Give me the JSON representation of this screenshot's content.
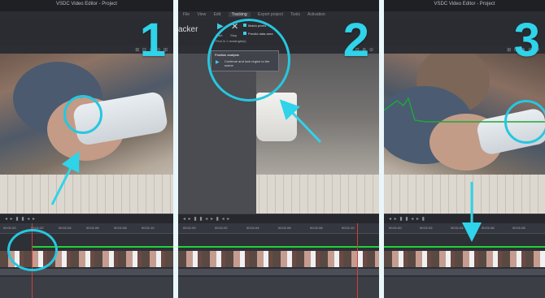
{
  "window": {
    "title": "VSDC Video Editor - Project"
  },
  "tabs": [
    "File",
    "View",
    "Edit",
    "Tracking",
    "Export project",
    "Tools",
    "Activation"
  ],
  "tracker_label": "acker",
  "ribbon": {
    "status": "Find in 1 rectangle(s)",
    "start_label": "Start",
    "stop_label": "Stop",
    "option_a": "Match pixels",
    "option_b": "Predict data area"
  },
  "popup": {
    "title": "Position analysis",
    "text": "Continue and lock region to the scene"
  },
  "numbers": [
    "1",
    "2",
    "3"
  ],
  "timeline": {
    "ticks": [
      "00:01:00",
      "00:01:02",
      "00:01:04",
      "00:01:06",
      "00:01:08",
      "00:01:10",
      "00:01:12",
      "00:01:14",
      "00:01:16",
      "00:01:18"
    ]
  },
  "colors": {
    "accent": "#2fd3ea",
    "track_green": "#20d33a",
    "divider": "#e9f7fb"
  }
}
